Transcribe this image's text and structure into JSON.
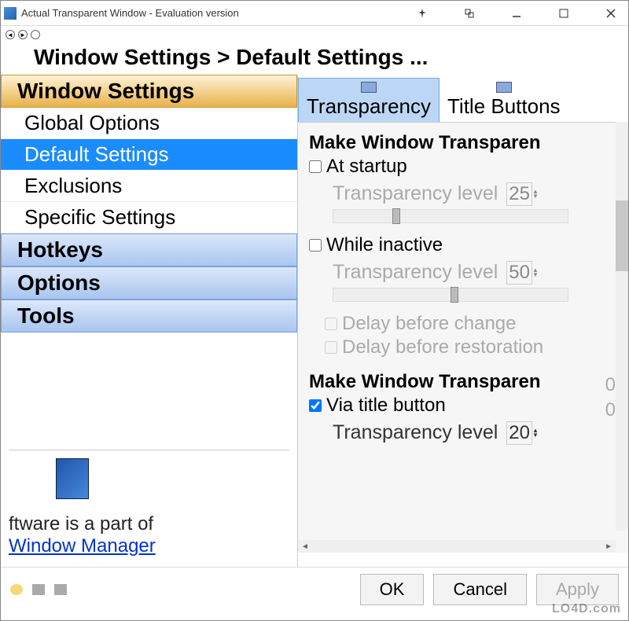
{
  "window": {
    "title": "Actual Transparent Window - Evaluation version"
  },
  "breadcrumb": "Window Settings > Default Settings ...",
  "sidebar": {
    "header": "Window Settings",
    "items": [
      {
        "label": "Global Options"
      },
      {
        "label": "Default Settings"
      },
      {
        "label": "Exclusions"
      },
      {
        "label": "Specific Settings"
      }
    ],
    "cats": [
      {
        "label": "Hotkeys"
      },
      {
        "label": "Options"
      },
      {
        "label": "Tools"
      }
    ]
  },
  "promo": {
    "text": "ftware is a part of",
    "link": "Window Manager"
  },
  "tabs": [
    {
      "label": "Transparency"
    },
    {
      "label": "Title Buttons"
    }
  ],
  "panel": {
    "title1": "Make Window Transparen",
    "at_startup": "At startup",
    "level_label": "Transparency level",
    "level1": "25",
    "while_inactive": "While inactive",
    "level2": "50",
    "delay_change": "Delay before change",
    "delay_restore": "Delay before restoration",
    "delay_change_val": "0",
    "delay_restore_val": "0",
    "title2": "Make Window Transparen",
    "via_title": "Via title button",
    "level3": "20"
  },
  "footer": {
    "ok": "OK",
    "cancel": "Cancel",
    "apply": "Apply"
  },
  "watermark": "LO4D.com"
}
